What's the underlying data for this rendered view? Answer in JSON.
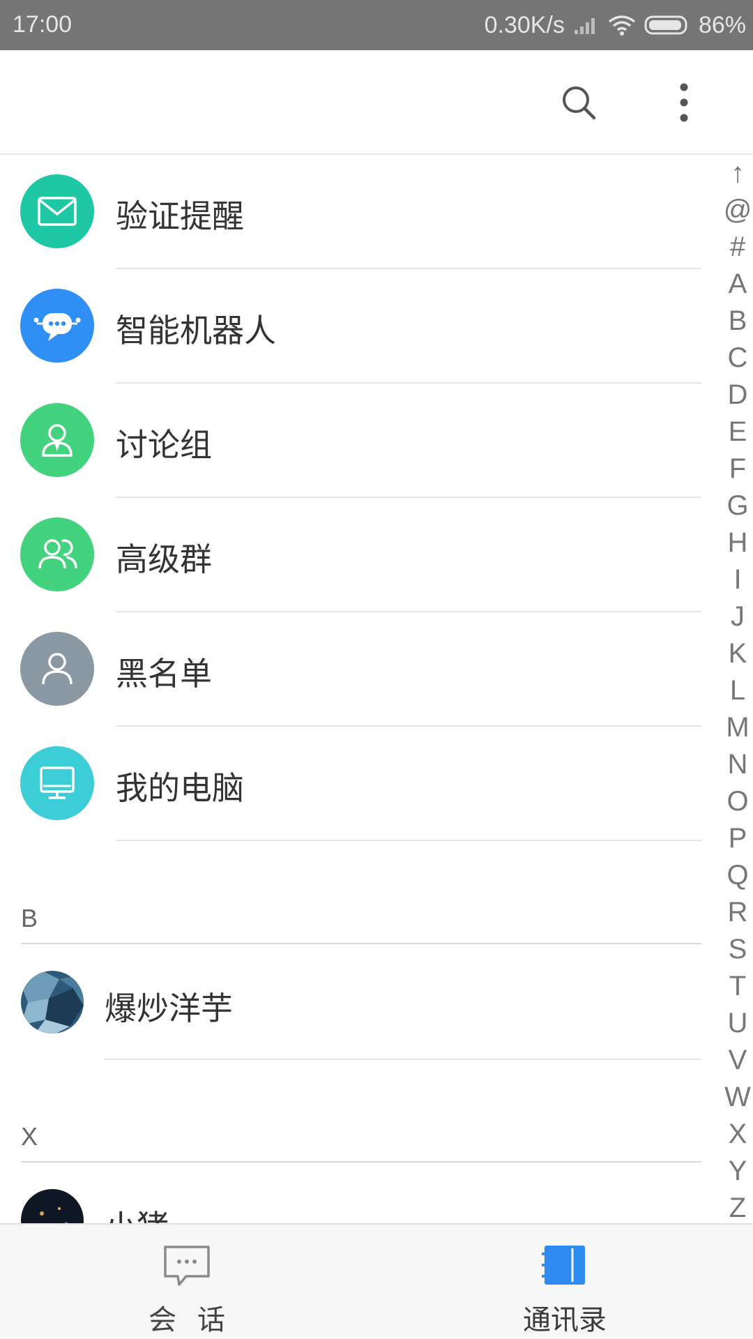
{
  "status_bar": {
    "time": "17:00",
    "net_speed": "0.30K/s",
    "battery_percent": "86%",
    "icons": [
      "signal-icon",
      "wifi-icon",
      "battery-icon"
    ]
  },
  "toolbar": {
    "icons": [
      "search-icon",
      "more-vertical-icon"
    ]
  },
  "fixed_items": [
    {
      "label": "验证提醒",
      "icon": "envelope-icon",
      "color": "#1ec8a5"
    },
    {
      "label": "智能机器人",
      "icon": "robot-chat-icon",
      "color": "#2f8ff5"
    },
    {
      "label": "讨论组",
      "icon": "user-icon",
      "color": "#43d27d"
    },
    {
      "label": "高级群",
      "icon": "group-icon",
      "color": "#43d27d"
    },
    {
      "label": "黑名单",
      "icon": "person-icon",
      "color": "#8a98a3"
    },
    {
      "label": "我的电脑",
      "icon": "monitor-icon",
      "color": "#3ccdd6"
    }
  ],
  "sections": [
    {
      "letter": "B",
      "contacts": [
        {
          "name": "爆炒洋芋"
        }
      ]
    },
    {
      "letter": "X",
      "contacts": [
        {
          "name": "小猪"
        }
      ]
    }
  ],
  "index_letters": [
    "↑",
    "@",
    "#",
    "A",
    "B",
    "C",
    "D",
    "E",
    "F",
    "G",
    "H",
    "I",
    "J",
    "K",
    "L",
    "M",
    "N",
    "O",
    "P",
    "Q",
    "R",
    "S",
    "T",
    "U",
    "V",
    "W",
    "X",
    "Y",
    "Z"
  ],
  "bottom_nav": {
    "chat_label": "会话",
    "contacts_label": "通讯录",
    "active_tab": "contacts",
    "active_color": "#2e8cf0"
  }
}
